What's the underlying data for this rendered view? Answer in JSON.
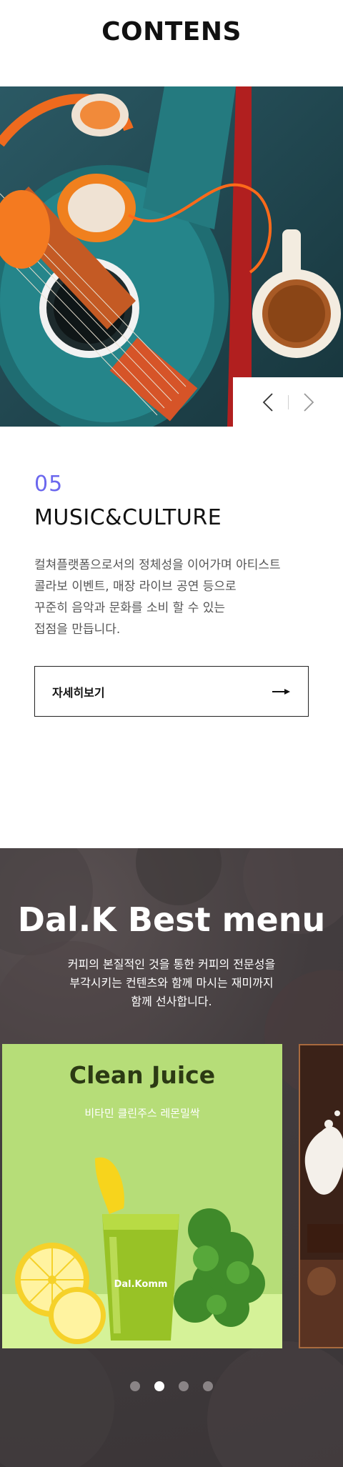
{
  "header": {
    "title": "CONTENS"
  },
  "content": {
    "number": "05",
    "title": "MUSIC&CULTURE",
    "description": [
      "컬쳐플랫폼으로서의 정체성을 이어가며 아티스트",
      "콜라보 이벤트, 매장 라이브 공연 등으로",
      "꾸준히 음악과 문화를 소비 할 수 있는",
      "접점을 만듭니다."
    ],
    "more_label": "자세히보기"
  },
  "best_menu": {
    "title": "Dal.K Best menu",
    "subtitle": [
      "커피의 본질적인 것을 통한 커피의 전문성을",
      "부각시키는 컨텐츠와 함께 마시는 재미까지",
      "함께 선사합니다."
    ],
    "card": {
      "title": "Clean Juice",
      "subtitle": "비타민 클린주스 레몬밀싹",
      "cup_logo": "Dal.Komm"
    },
    "dots": {
      "count": 4,
      "active_index": 1
    }
  },
  "colors": {
    "accent": "#6b67ee",
    "card_green": "#b6dd78"
  },
  "icons": [
    "chevron-left-icon",
    "chevron-right-icon",
    "arrow-right-icon"
  ]
}
